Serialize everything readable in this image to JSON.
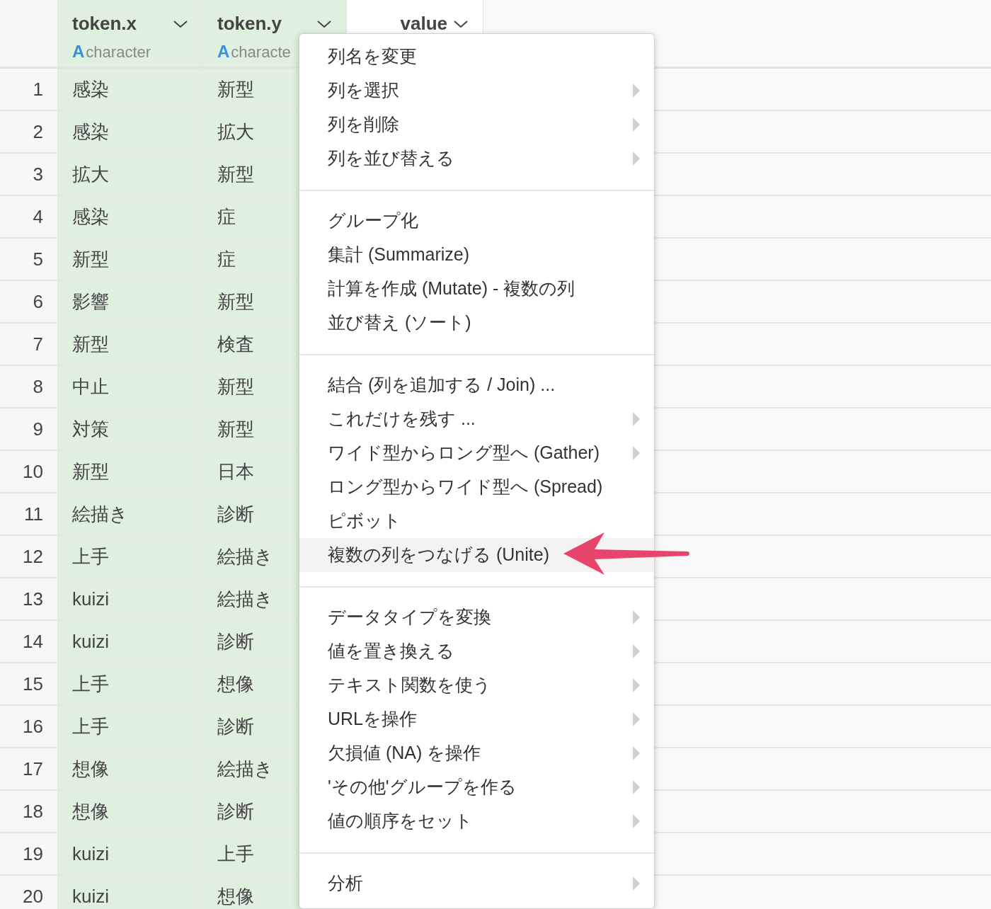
{
  "table": {
    "columns": [
      {
        "name": "token.x",
        "type_badge": "A",
        "type": "character",
        "selected": true
      },
      {
        "name": "token.y",
        "type_badge": "A",
        "type": "characte",
        "selected": true
      },
      {
        "name": "value",
        "selected": false
      }
    ],
    "rows": [
      {
        "number": "1",
        "cells": [
          "感染",
          "新型"
        ]
      },
      {
        "number": "2",
        "cells": [
          "感染",
          "拡大"
        ]
      },
      {
        "number": "3",
        "cells": [
          "拡大",
          "新型"
        ]
      },
      {
        "number": "4",
        "cells": [
          "感染",
          "症"
        ]
      },
      {
        "number": "5",
        "cells": [
          "新型",
          "症"
        ]
      },
      {
        "number": "6",
        "cells": [
          "影響",
          "新型"
        ]
      },
      {
        "number": "7",
        "cells": [
          "新型",
          "検査"
        ]
      },
      {
        "number": "8",
        "cells": [
          "中止",
          "新型"
        ]
      },
      {
        "number": "9",
        "cells": [
          "対策",
          "新型"
        ]
      },
      {
        "number": "10",
        "cells": [
          "新型",
          "日本"
        ]
      },
      {
        "number": "11",
        "cells": [
          "絵描き",
          "診断"
        ]
      },
      {
        "number": "12",
        "cells": [
          "上手",
          "絵描き"
        ]
      },
      {
        "number": "13",
        "cells": [
          "kuizi",
          "絵描き"
        ]
      },
      {
        "number": "14",
        "cells": [
          "kuizi",
          "診断"
        ]
      },
      {
        "number": "15",
        "cells": [
          "上手",
          "想像"
        ]
      },
      {
        "number": "16",
        "cells": [
          "上手",
          "診断"
        ]
      },
      {
        "number": "17",
        "cells": [
          "想像",
          "絵描き"
        ]
      },
      {
        "number": "18",
        "cells": [
          "想像",
          "診断"
        ]
      },
      {
        "number": "19",
        "cells": [
          "kuizi",
          "上手"
        ]
      },
      {
        "number": "20",
        "cells": [
          "kuizi",
          "想像"
        ]
      }
    ]
  },
  "context_menu": {
    "groups": [
      [
        {
          "label": "列名を変更",
          "submenu": false,
          "selected": false
        },
        {
          "label": "列を選択",
          "submenu": true,
          "selected": false
        },
        {
          "label": "列を削除",
          "submenu": true,
          "selected": false
        },
        {
          "label": "列を並び替える",
          "submenu": true,
          "selected": false
        }
      ],
      [
        {
          "label": "グループ化",
          "submenu": false,
          "selected": false
        },
        {
          "label": "集計 (Summarize)",
          "submenu": false,
          "selected": false
        },
        {
          "label": "計算を作成 (Mutate) - 複数の列",
          "submenu": false,
          "selected": false
        },
        {
          "label": "並び替え (ソート)",
          "submenu": false,
          "selected": false
        }
      ],
      [
        {
          "label": "結合 (列を追加する / Join) ...",
          "submenu": false,
          "selected": false
        },
        {
          "label": "これだけを残す ...",
          "submenu": true,
          "selected": false
        },
        {
          "label": "ワイド型からロング型へ (Gather)",
          "submenu": true,
          "selected": false
        },
        {
          "label": "ロング型からワイド型へ (Spread)",
          "submenu": false,
          "selected": false
        },
        {
          "label": "ピボット",
          "submenu": false,
          "selected": false
        },
        {
          "label": "複数の列をつなげる (Unite)",
          "submenu": false,
          "selected": true
        }
      ],
      [
        {
          "label": "データタイプを変換",
          "submenu": true,
          "selected": false
        },
        {
          "label": "値を置き換える",
          "submenu": true,
          "selected": false
        },
        {
          "label": "テキスト関数を使う",
          "submenu": true,
          "selected": false
        },
        {
          "label": "URLを操作",
          "submenu": true,
          "selected": false
        },
        {
          "label": "欠損値 (NA) を操作",
          "submenu": true,
          "selected": false
        },
        {
          "label": "'その他'グループを作る",
          "submenu": true,
          "selected": false
        },
        {
          "label": "値の順序をセット",
          "submenu": true,
          "selected": false
        }
      ],
      [
        {
          "label": "分析",
          "submenu": true,
          "selected": false
        }
      ]
    ]
  }
}
